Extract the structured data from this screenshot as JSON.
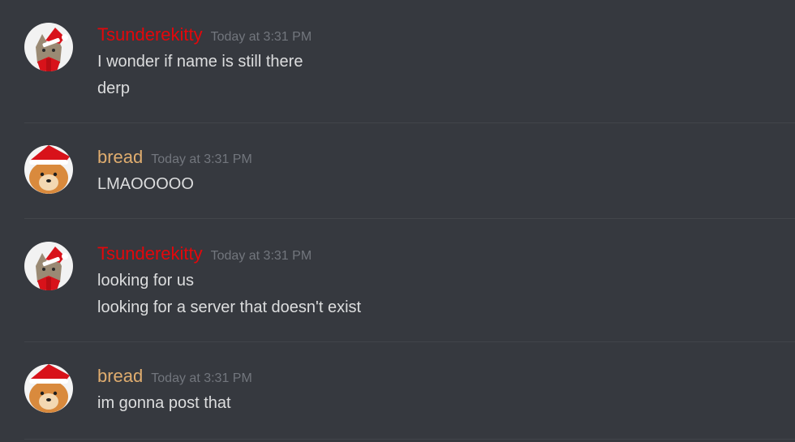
{
  "users": {
    "tsunderekitty": {
      "name": "Tsunderekitty",
      "color": "#e3070b",
      "avatar": "kitty-santa-avatar"
    },
    "bread": {
      "name": "bread",
      "color": "#e0ad6f",
      "avatar": "shiba-santa-avatar"
    }
  },
  "messages": [
    {
      "author": "Tsunderekitty",
      "timestamp": "Today at 3:31 PM",
      "lines": [
        "I wonder if name is still there",
        "derp"
      ]
    },
    {
      "author": "bread",
      "timestamp": "Today at 3:31 PM",
      "lines": [
        "LMAOOOOO"
      ]
    },
    {
      "author": "Tsunderekitty",
      "timestamp": "Today at 3:31 PM",
      "lines": [
        "looking for us",
        "looking for a server that doesn't exist"
      ]
    },
    {
      "author": "bread",
      "timestamp": "Today at 3:31 PM",
      "lines": [
        "im gonna post that"
      ]
    }
  ]
}
